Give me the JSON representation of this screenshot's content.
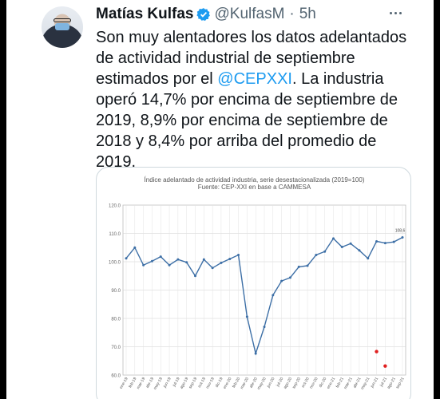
{
  "tweet": {
    "author_name": "Matías Kulfas",
    "handle": "@KulfasM",
    "separator": "·",
    "time": "5h",
    "text_line1": "Son muy alentadores los datos adelantados",
    "text_line2": "de actividad industrial de septiembre",
    "text_line3_before": "estimados por el ",
    "mention": "@CEPXXI",
    "text_line3_after": ". La industria",
    "text_line4": "operó 14,7% por encima de septiembre de",
    "text_line5": "2019, 8,9% por encima de septiembre de",
    "text_line6": "2018 y 8,4% por arriba del promedio de",
    "text_line7": "2019."
  },
  "colors": {
    "accent": "#1d9bf0",
    "line": "#3d6fa6",
    "highlight": "#e02020"
  },
  "chart_data": {
    "type": "line",
    "title": "Índice adelantado de actividad industria, serie desestacionalizada (2019=100)",
    "subtitle": "Fuente: CEP-XXI en base a CAMMESA",
    "ylim": [
      60,
      120
    ],
    "yticks": [
      "60.0",
      "70.0",
      "80.0",
      "90.0",
      "100.0",
      "110.0",
      "120.0"
    ],
    "categories": [
      "ene-19",
      "feb-19",
      "mar-19",
      "abr-19",
      "may-19",
      "jun-19",
      "jul-19",
      "ago-19",
      "sep-19",
      "oct-19",
      "nov-19",
      "dic-19",
      "ene-20",
      "feb-20",
      "mar-20",
      "abr-20",
      "may-20",
      "jun-20",
      "jul-20",
      "ago-20",
      "sep-20",
      "oct-20",
      "nov-20",
      "dic-20",
      "ene-21",
      "feb-21",
      "mar-21",
      "abr-21",
      "may-21",
      "jun-21",
      "jul-21",
      "ago-21",
      "sep-21"
    ],
    "values": [
      101.2,
      105.0,
      98.8,
      100.2,
      101.8,
      98.8,
      100.8,
      99.8,
      95.0,
      100.8,
      97.8,
      99.6,
      101.0,
      102.4,
      80.6,
      67.6,
      77.0,
      88.2,
      93.2,
      94.4,
      98.2,
      98.6,
      102.4,
      103.6,
      108.2,
      105.2,
      106.4,
      104.0,
      101.2,
      107.2,
      106.6,
      107.0,
      108.6
    ],
    "end_label": "108,6",
    "markers": [
      {
        "x": "jun-21",
        "y": 68.3
      },
      {
        "x": "jul-21",
        "y": 63.2
      }
    ]
  }
}
